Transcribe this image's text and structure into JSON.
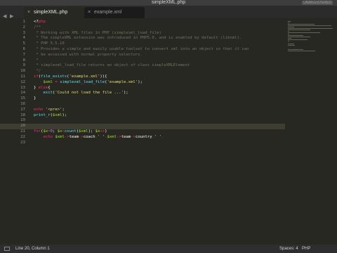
{
  "window": {
    "title": "simpleXML.php",
    "badge": "UNREGISTERED"
  },
  "tabs": [
    {
      "label": "simpleXML.php",
      "active": true
    },
    {
      "label": "example.xml",
      "active": false
    }
  ],
  "nav": {
    "left": "◀",
    "right": "▶"
  },
  "editor": {
    "line_numbers": [
      "1",
      "2",
      "3",
      "4",
      "5",
      "6",
      "7",
      "8",
      "9",
      "10",
      "11",
      "12",
      "13",
      "14",
      "15",
      "16",
      "17",
      "18",
      "19",
      "20",
      "21",
      "22",
      "23"
    ],
    "lines": [
      "<?php",
      "/**",
      " * Working with XML files in PHP (simplexml_load_file)",
      " * The simpleXML extension was introduced in PHP5.0, and is enabled by default (libxml).",
      " * PHP 5.5.10",
      " * Provides a simple and easily usable toolset to convert xml into an object so that it can",
      " * be accessed with normal property selectors.",
      " *",
      " * simplexml_load_file returns an object of class simpleXMLElement",
      " */",
      "if(file_exists('example.xml')){",
      "    $xml = simplexml_load_file('example.xml');",
      "} else{",
      "    exit('Could not load the file ...');",
      "}",
      "",
      "echo '<pre>';",
      "print_r($xml);",
      "",
      "",
      "for($x=0; $x<count($xml); $x++)",
      "    echo $xml->team->coach.' '.$xml->team->country.' '.",
      ""
    ]
  },
  "status": {
    "position": "Line 20, Column 1",
    "spaces": "Spaces: 4",
    "syntax": "PHP"
  },
  "colors": {
    "background": "#272822",
    "keyword": "#f92672",
    "string": "#e6db74",
    "comment": "#75715e",
    "function": "#66d9ef"
  }
}
